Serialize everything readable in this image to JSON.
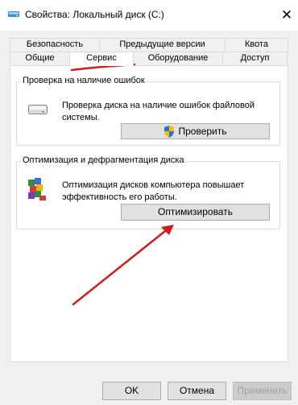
{
  "window": {
    "title": "Свойства: Локальный диск (C:)",
    "close_glyph": "✕"
  },
  "tabs": {
    "back_row": [
      {
        "label": "Безопасность"
      },
      {
        "label": "Предыдущие версии"
      },
      {
        "label": "Квота"
      }
    ],
    "front_row": [
      {
        "label": "Общие"
      },
      {
        "label": "Сервис",
        "active": true
      },
      {
        "label": "Оборудование"
      },
      {
        "label": "Доступ"
      }
    ]
  },
  "error_check": {
    "title": "Проверка на наличие ошибок",
    "description": "Проверка диска на наличие ошибок файловой системы.",
    "button": "Проверить",
    "icon": "drive-icon"
  },
  "optimize": {
    "title": "Оптимизация и дефрагментация диска",
    "description": "Оптимизация дисков компьютера повышает эффективность его работы.",
    "button": "Оптимизировать",
    "icon": "defrag-icon"
  },
  "footer": {
    "ok": "OK",
    "cancel": "Отмена",
    "apply": "Применить"
  },
  "annotations": {
    "underline_color": "#d01c1c",
    "arrow_color": "#d01c1c"
  }
}
